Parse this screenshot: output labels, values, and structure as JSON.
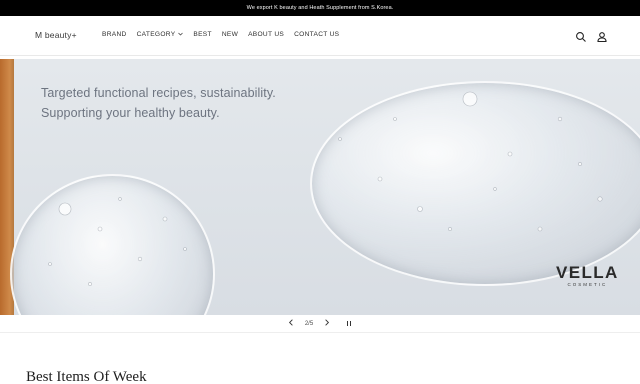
{
  "announcement": {
    "text": "We export K beauty and Heath Supplement from S.Korea."
  },
  "header": {
    "logo": "M beauty+",
    "nav": [
      {
        "label": "BRAND"
      },
      {
        "label": "CATEGORY",
        "has_dropdown": true,
        "icon": "chevron-down-icon"
      },
      {
        "label": "BEST"
      },
      {
        "label": "NEW"
      },
      {
        "label": "ABOUT US"
      },
      {
        "label": "CONTACT US"
      }
    ],
    "icons": [
      "search-icon",
      "user-icon"
    ]
  },
  "banner": {
    "headline_line1": "Targeted functional recipes, sustainability.",
    "headline_line2": "Supporting your healthy beauty.",
    "brand_name": "VELLA",
    "brand_sub": "COSMETIC",
    "accent_stripe_color": "#c27a3a",
    "background_color": "#dfe3e8"
  },
  "slider": {
    "prev_icon": "chevron-left-icon",
    "next_icon": "chevron-right-icon",
    "counter": "2/5",
    "pause_icon": "pause-icon"
  },
  "section": {
    "title": "Best Items Of Week"
  }
}
